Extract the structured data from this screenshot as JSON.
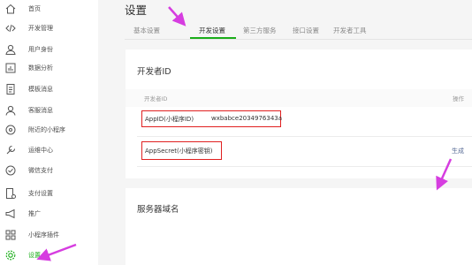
{
  "sidebar": {
    "items": [
      {
        "label": "首页",
        "icon": "home-icon"
      },
      {
        "label": "开发管理",
        "icon": "code-icon"
      },
      {
        "label": "用户身份",
        "icon": "user-icon"
      },
      {
        "label": "数据分析",
        "icon": "chart-icon"
      },
      {
        "label": "模板消息",
        "icon": "document-icon"
      },
      {
        "label": "客服消息",
        "icon": "customer-service-icon"
      },
      {
        "label": "附近的小程序",
        "icon": "location-icon"
      },
      {
        "label": "运维中心",
        "icon": "wrench-icon"
      },
      {
        "label": "微信支付",
        "icon": "wechat-pay-icon"
      },
      {
        "label": "支付设置",
        "icon": "payment-settings-icon"
      },
      {
        "label": "推广",
        "icon": "megaphone-icon"
      },
      {
        "label": "小程序插件",
        "icon": "plugin-grid-icon"
      },
      {
        "label": "设置",
        "icon": "settings-gear-icon"
      }
    ],
    "active_color": "#1aad19"
  },
  "main": {
    "title": "设置",
    "tabs": [
      {
        "label": "基本设置"
      },
      {
        "label": "开发设置"
      },
      {
        "label": "第三方服务"
      },
      {
        "label": "接口设置"
      },
      {
        "label": "开发者工具"
      }
    ],
    "active_tab": "开发设置",
    "developer_card": {
      "title": "开发者ID",
      "header_left": "开发者ID",
      "header_right": "操作",
      "appid_label": "AppID(小程序ID)",
      "appid_value": "wxbabce2034976343a",
      "appsecret_label": "AppSecret(小程序密钥)",
      "generate_link": "生成"
    },
    "server_card": {
      "title": "服务器域名"
    }
  },
  "annotation_colors": {
    "box": "#e02020",
    "arrow": "#d63de0"
  }
}
